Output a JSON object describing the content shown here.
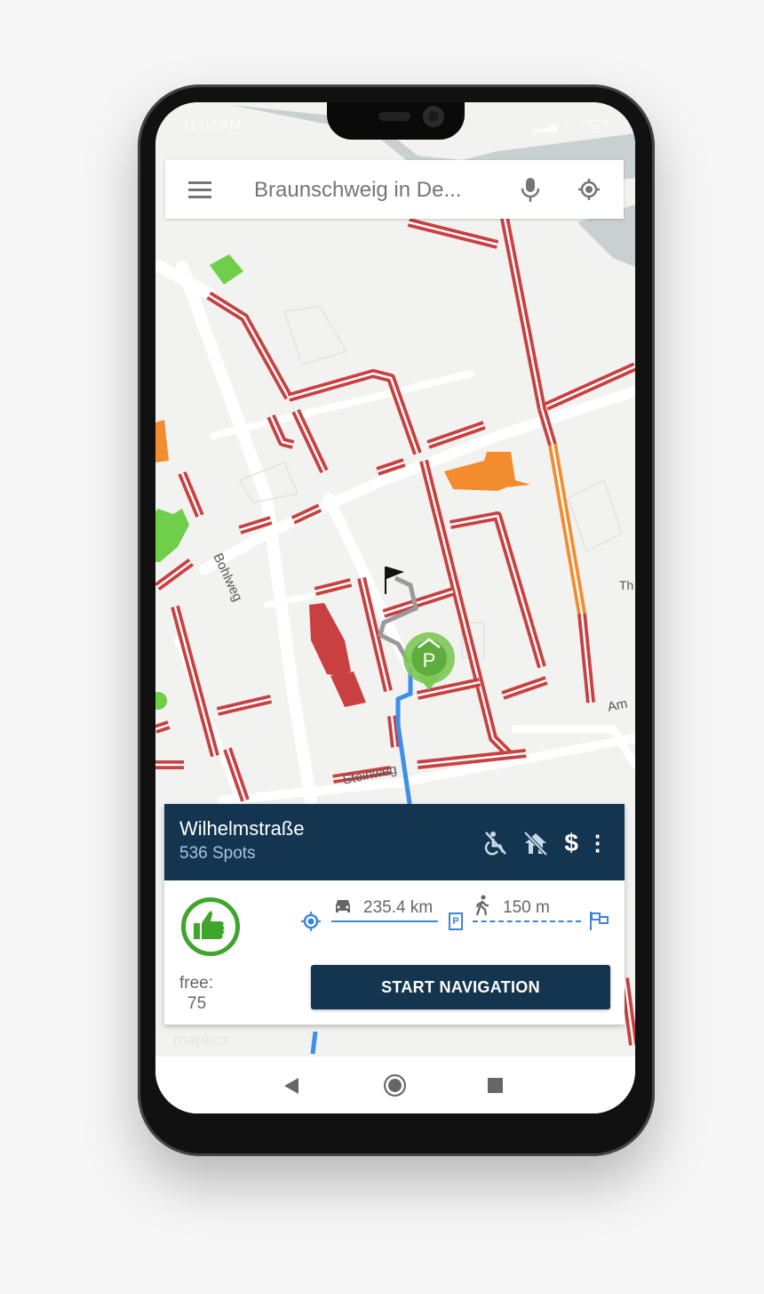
{
  "status_bar": {
    "time": "11:07 AM",
    "battery": "52"
  },
  "search": {
    "query": "Braunschweig in  De...",
    "menu_icon": "hamburger-menu-icon",
    "mic_icon": "microphone-icon",
    "locate_icon": "gps-locate-icon"
  },
  "map": {
    "labels": {
      "bohlweg": "Bohlweg",
      "steinweg": "Steinweg",
      "am": "Am",
      "th": "Th"
    },
    "colors": {
      "occupied": "#c94040",
      "medium": "#f28c2e",
      "free": "#6fcf4a",
      "route_drive": "#3d8fe8",
      "route_walk": "#9a9a9a"
    },
    "attribution": "mapbox"
  },
  "panel": {
    "title": "Wilhelmstraße",
    "spots": "536 Spots",
    "icons": [
      "no-wheelchair-icon",
      "no-covered-parking-icon",
      "paid-parking-icon",
      "more-vert-icon"
    ],
    "rating_icon": "thumbs-up-icon",
    "free_label": "free:",
    "free_count": "75",
    "drive_distance": "235.4 km",
    "walk_distance": "150 m",
    "start_button": "START NAVIGATION"
  },
  "colors": {
    "panel_header": "#14354f",
    "accent_blue": "#3b86d8",
    "good_green": "#3fa62a"
  }
}
